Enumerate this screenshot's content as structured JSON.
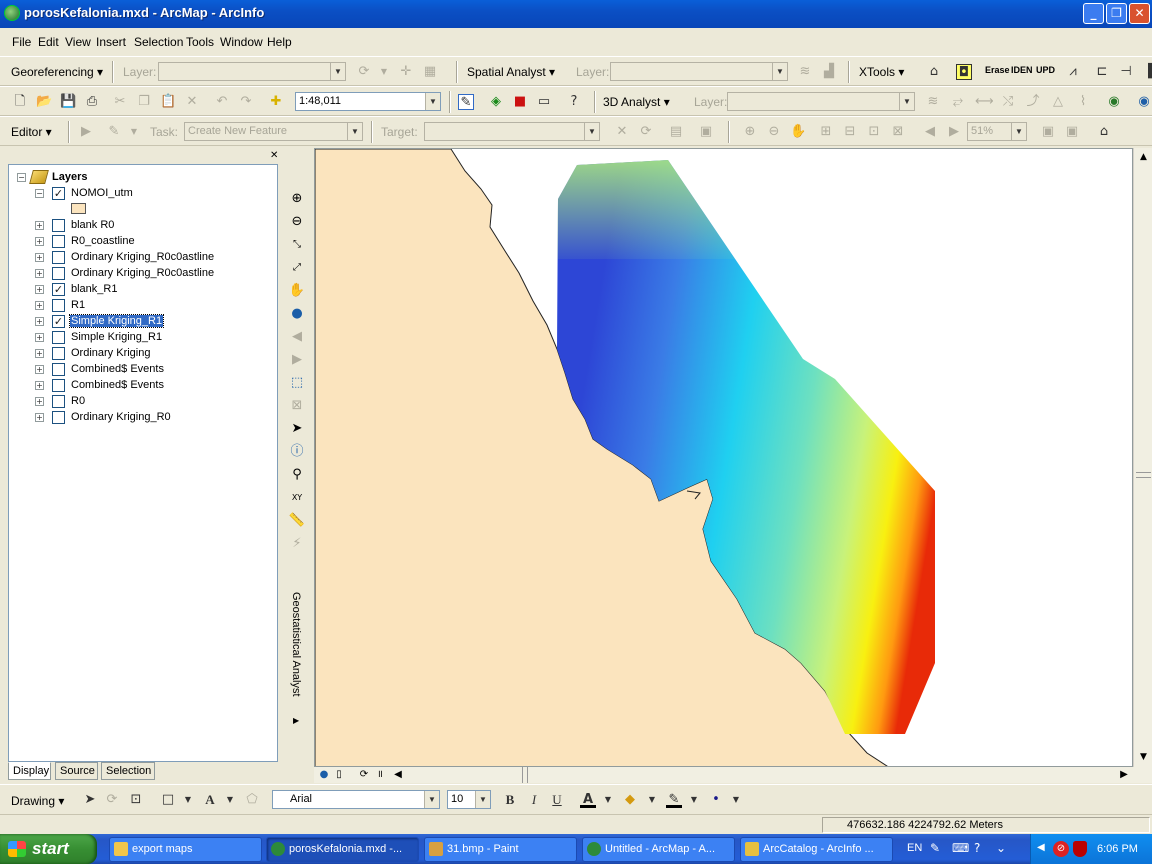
{
  "window": {
    "title": "porosKefalonia.mxd - ArcMap - ArcInfo",
    "min": "_",
    "max": "❐",
    "close": "✕"
  },
  "menu": [
    "File",
    "Edit",
    "View",
    "Insert",
    "Selection",
    "Tools",
    "Window",
    "Help"
  ],
  "toolbar1": {
    "georeferencing": "Georeferencing ▾",
    "layer_label_1": "Layer:",
    "spatial_analyst": "Spatial Analyst ▾",
    "layer_label_2": "Layer:",
    "xtools": "XTools ▾",
    "erase": "Erase",
    "iden": "IDEN",
    "upd": "UPD"
  },
  "toolbar2": {
    "scale": "1:48,011",
    "analyst3d": "3D Analyst ▾",
    "layer_label": "Layer:"
  },
  "toolbar3": {
    "editor": "Editor ▾",
    "task_label": "Task:",
    "task_value": "Create New Feature",
    "target_label": "Target:",
    "zoom_pct": "51%"
  },
  "toc": {
    "root": "Layers",
    "layers": [
      {
        "name": "NOMOI_utm",
        "checked": true,
        "expanded": true
      },
      {
        "name": "blank R0",
        "checked": false
      },
      {
        "name": "R0_coastline",
        "checked": false
      },
      {
        "name": "Ordinary Kriging_R0c0astline",
        "checked": false
      },
      {
        "name": "Ordinary Kriging_R0c0astline",
        "checked": false
      },
      {
        "name": "blank_R1",
        "checked": true
      },
      {
        "name": "R1",
        "checked": false
      },
      {
        "name": "Simple Kriging_R1",
        "checked": true,
        "selected": true
      },
      {
        "name": "Simple Kriging_R1",
        "checked": false
      },
      {
        "name": "Ordinary Kriging",
        "checked": false
      },
      {
        "name": "Combined$ Events",
        "checked": false
      },
      {
        "name": "Combined$ Events",
        "checked": false
      },
      {
        "name": "R0",
        "checked": false
      },
      {
        "name": "Ordinary Kriging_R0",
        "checked": false
      }
    ],
    "tabs": [
      "Display",
      "Source",
      "Selection"
    ]
  },
  "side_panel": {
    "label": "Geostatistical Analyst"
  },
  "drawing": {
    "drawing_label": "Drawing ▾",
    "font": "Arial",
    "size": "10",
    "bold": "B",
    "italic": "I",
    "underline": "U"
  },
  "status": {
    "coords": "476632.186  4224792.62 Meters"
  },
  "taskbar": {
    "start": "start",
    "items": [
      {
        "label": "export maps"
      },
      {
        "label": "porosKefalonia.mxd -...",
        "active": true
      },
      {
        "label": "31.bmp - Paint"
      },
      {
        "label": "Untitled - ArcMap - A..."
      },
      {
        "label": "ArcCatalog - ArcInfo ..."
      }
    ],
    "lang": "EN",
    "clock": "6:06 PM"
  },
  "colors": {
    "land": "#fbe4be",
    "titlebar": "#0a5fd8",
    "selection": "#316ac5"
  },
  "icons": [
    "zoom-in-icon",
    "zoom-out-icon",
    "fixed-zoom-in-icon",
    "fixed-zoom-out-icon",
    "pan-icon",
    "full-extent-icon",
    "back-icon",
    "forward-icon",
    "select-features-icon",
    "clear-selection-icon",
    "select-elements-icon",
    "identify-icon",
    "find-icon",
    "go-to-xy-icon",
    "measure-icon",
    "hyperlink-icon"
  ]
}
